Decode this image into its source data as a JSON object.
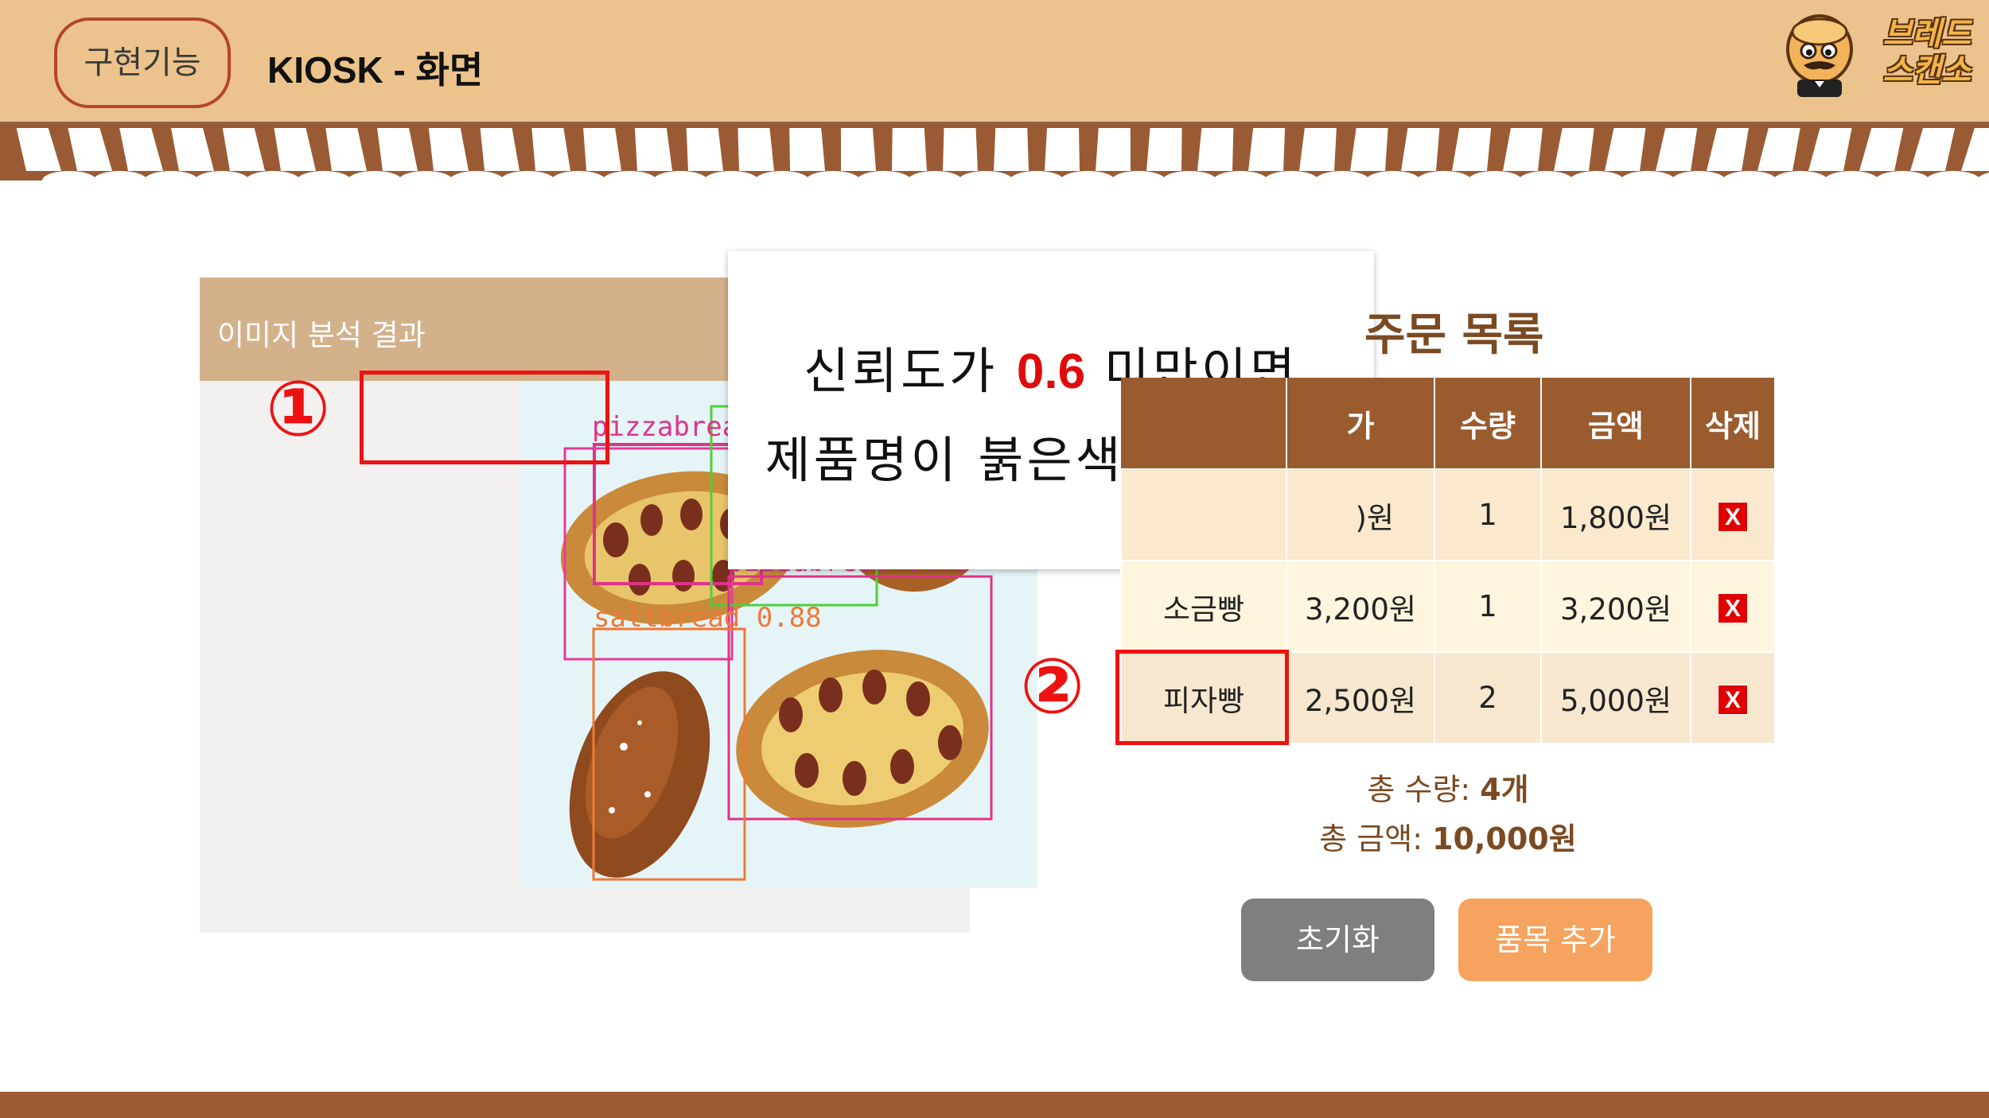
{
  "header": {
    "badge": "구현기능",
    "title": "KIOSK - 화면",
    "logo_line1": "브레드",
    "logo_line2": "스캔소"
  },
  "panel": {
    "title": "이미지 분석 결과",
    "detections": [
      {
        "label": "pizzabread 0.52",
        "color": "#e0338a"
      },
      {
        "label": "pizzabread 0.79",
        "color": "#e0338a"
      },
      {
        "label": "saltbread 0.88",
        "color": "#f07838"
      }
    ]
  },
  "markers": {
    "one": "①",
    "two": "②"
  },
  "callout": {
    "line1_pre": "신뢰도가 ",
    "line1_value": "0.6",
    "line1_post": " 미만이면",
    "line2": "제품명이 붉은색으로 출력"
  },
  "order": {
    "title": "주문 목록",
    "columns": [
      "",
      "가",
      "수량",
      "금액",
      "삭제"
    ],
    "rows": [
      {
        "name": "",
        "price": ")원",
        "qty": "1",
        "amount": "1,800원",
        "delete": "X"
      },
      {
        "name": "소금빵",
        "price": "3,200원",
        "qty": "1",
        "amount": "3,200원",
        "delete": "X"
      },
      {
        "name": "피자빵",
        "price": "2,500원",
        "qty": "2",
        "amount": "5,000원",
        "delete": "X",
        "low_confidence": true
      }
    ],
    "total_qty_label": "총 수량: ",
    "total_qty": "4개",
    "total_amount_label": "총 금액: ",
    "total_amount": "10,000원"
  },
  "buttons": {
    "reset": "초기화",
    "add": "품목 추가"
  },
  "colors": {
    "header_bg": "#ecc38c",
    "awning_brown": "#9a5b34",
    "table_header": "#9a5b2e",
    "highlight_red": "#e00b0b",
    "add_button": "#f5a35f",
    "reset_button": "#7f7f7f"
  }
}
